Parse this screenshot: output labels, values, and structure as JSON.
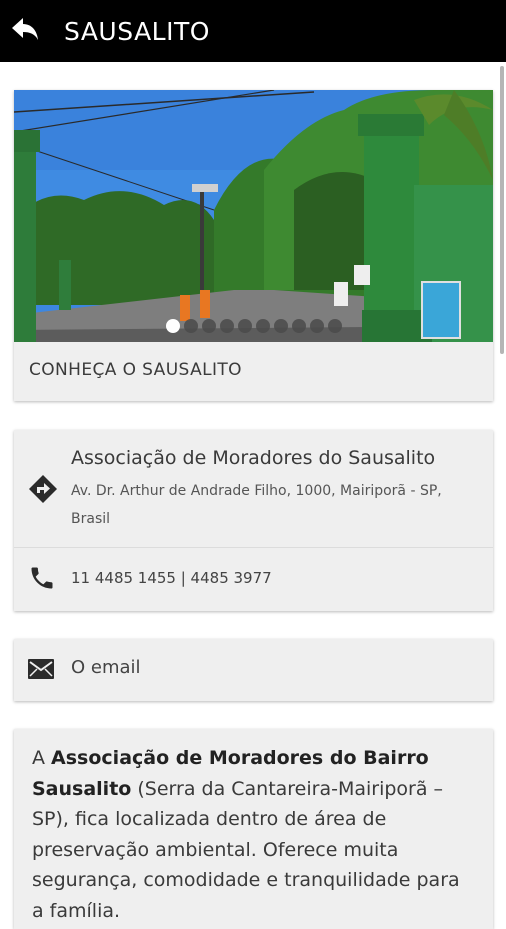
{
  "appbar": {
    "title": "SAUSALITO",
    "back_icon": "arrow-back-icon"
  },
  "hero": {
    "caption": "CONHEÇA O SAUSALITO",
    "slide_count": 11,
    "active_slide": 1
  },
  "contact": {
    "name": "Associação de Moradores do Sausalito",
    "address": "Av. Dr. Arthur de Andrade Filho, 1000, Mairiporã - SP, Brasil",
    "address_icon": "directions-icon",
    "phone": "11 4485 1455 | 4485 3977",
    "phone_icon": "phone-icon"
  },
  "email": {
    "label": "O email",
    "icon": "mail-icon"
  },
  "about": {
    "prefix": "A ",
    "bold": "Associação de Moradores do Bairro Sausalito",
    "rest": " (Serra da Cantareira-Mairiporã – SP), fica localizada dentro de área de preservação ambiental.  Oferece muita segurança, comodidade  e tranquilidade para a família."
  },
  "colors": {
    "appbar_bg": "#000000",
    "card_bg": "#efefef",
    "text": "#3a3a3a"
  }
}
